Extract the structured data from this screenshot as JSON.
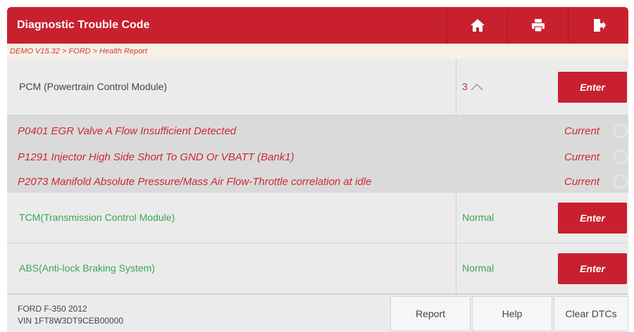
{
  "header": {
    "title": "Diagnostic Trouble Code",
    "icons": [
      "home-icon",
      "print-icon",
      "exit-icon"
    ]
  },
  "breadcrumb": "DEMO V15.32 > FORD > Health Report",
  "modules": [
    {
      "name": "PCM (Powertrain Control Module)",
      "status": "3",
      "status_color": "#cc2a33",
      "name_color": "#cc2a33",
      "enter_label": "Enter"
    },
    {
      "name": "TCM(Transmission Control Module)",
      "status": "Normal",
      "status_color": "#3aa655",
      "name_color": "#3aa655",
      "enter_label": "Enter"
    },
    {
      "name": "ABS(Anti-lock Braking System)",
      "status": "Normal",
      "status_color": "#3aa655",
      "name_color": "#3aa655",
      "enter_label": "Enter"
    }
  ],
  "dtcs": [
    {
      "code": "P0401 EGR Valve A Flow Insufficient Detected",
      "state": "Current"
    },
    {
      "code": "P1291 Injector High Side Short To GND Or VBATT (Bank1)",
      "state": "Current"
    },
    {
      "code": "P2073 Manifold Absolute Pressure/Mass Air Flow-Throttle correlation at idle",
      "state": "Current"
    }
  ],
  "footer": {
    "vehicle_line1": "FORD F-350 2012",
    "vehicle_line2": "VIN 1FT8W3DT9CEB00000",
    "report_label": "Report",
    "help_label": "Help",
    "clear_label": "Clear DTCs"
  },
  "colors": {
    "accent": "#c8202e",
    "fault": "#cc2a33",
    "normal": "#3aa655"
  }
}
